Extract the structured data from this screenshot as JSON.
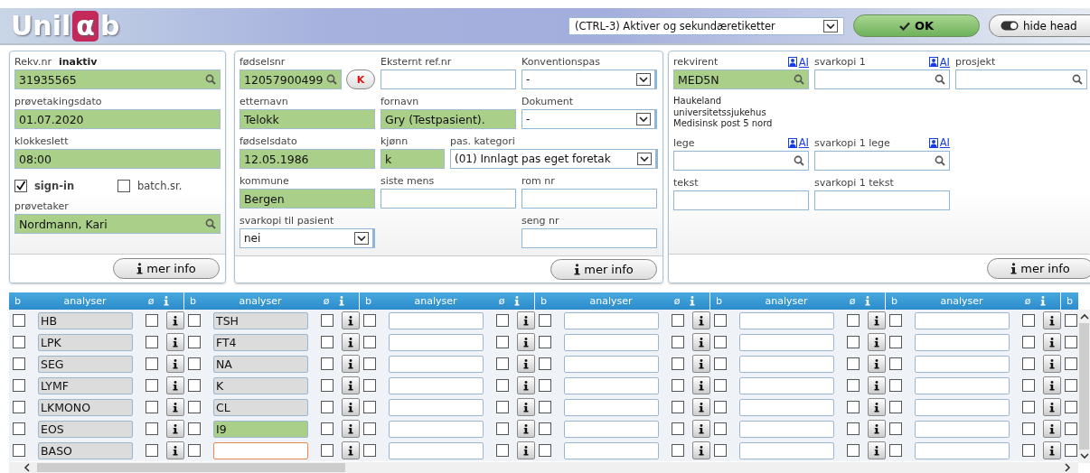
{
  "header": {
    "logo": {
      "prefix": "Unil",
      "mark": "α",
      "suffix": "b"
    },
    "print_select": "(CTRL-3) Aktiver og sekundæretiketter",
    "ok_button": "OK",
    "hide_button": "hide head"
  },
  "panels": [
    {
      "rows": [
        {
          "kind": "fields",
          "cells": [
            {
              "label": "Rekv.nr",
              "status": "inaktiv",
              "field": {
                "kind": "search",
                "value": "31935565",
                "highlighted": true
              }
            }
          ]
        },
        {
          "kind": "fields",
          "cells": [
            {
              "label": "prøvetakingsdato",
              "field": {
                "kind": "text",
                "value": "01.07.2020",
                "highlighted": true
              }
            }
          ]
        },
        {
          "kind": "fields",
          "cells": [
            {
              "label": "klokkeslett",
              "field": {
                "kind": "text",
                "value": "08:00",
                "highlighted": true
              }
            }
          ]
        },
        {
          "kind": "checks",
          "items": [
            {
              "label": "sign-in",
              "checked": true
            },
            {
              "label": "batch.sr.",
              "checked": false
            }
          ]
        },
        {
          "kind": "fields",
          "cells": [
            {
              "label": "prøvetaker",
              "field": {
                "kind": "search",
                "value": "Nordmann, Kari",
                "highlighted": true
              }
            }
          ]
        }
      ],
      "footer_button": "mer info"
    },
    {
      "rows": [
        {
          "kind": "fields",
          "cells": [
            {
              "label": "fødselsnr",
              "field": {
                "kind": "search",
                "value": "12057900499",
                "highlighted": true
              },
              "button": "K"
            },
            {
              "label": "Eksternt ref.nr",
              "field": {
                "kind": "text",
                "highlighted": false
              }
            },
            {
              "label": "Konventionspas",
              "field": {
                "kind": "select",
                "value": "-",
                "highlighted": false
              }
            }
          ]
        },
        {
          "kind": "fields",
          "cells": [
            {
              "label": "etternavn",
              "field": {
                "kind": "text",
                "value": "Telokk",
                "highlighted": true
              }
            },
            {
              "label": "fornavn",
              "field": {
                "kind": "text",
                "value": "Gry (Testpasient).",
                "highlighted": true
              }
            },
            {
              "label": "Dokument",
              "field": {
                "kind": "select",
                "value": "-",
                "highlighted": false
              }
            }
          ]
        },
        {
          "kind": "fields",
          "cells": [
            {
              "label": "fødselsdato",
              "field": {
                "kind": "text",
                "value": "12.05.1986",
                "highlighted": true
              }
            },
            {
              "label": "kjønn",
              "field": {
                "kind": "text",
                "value": "k",
                "highlighted": true
              }
            },
            {
              "label": "pas. kategori",
              "field": {
                "kind": "select",
                "value": "(01) Innlagt pas eget foretak",
                "highlighted": false
              }
            }
          ]
        },
        {
          "kind": "fields",
          "cells": [
            {
              "label": "kommune",
              "field": {
                "kind": "text",
                "value": "Bergen",
                "highlighted": true
              }
            },
            {
              "label": "siste mens",
              "field": {
                "kind": "text",
                "highlighted": false
              }
            },
            {
              "label": "rom nr",
              "field": {
                "kind": "text",
                "highlighted": false
              }
            }
          ]
        },
        {
          "kind": "fields",
          "cells": [
            {
              "label": "svarkopi til pasient",
              "field": {
                "kind": "select",
                "value": "nei",
                "highlighted": false
              }
            },
            "",
            {
              "label": "seng nr",
              "field": {
                "kind": "text",
                "highlighted": false
              }
            }
          ]
        }
      ],
      "footer_button": "mer info"
    },
    {
      "rows": [
        {
          "kind": "fields",
          "cells": [
            {
              "label": "rekvirent",
              "link": "AI",
              "field": {
                "kind": "search",
                "value": "MED5N",
                "highlighted": true
              }
            },
            {
              "label": "svarkopi 1",
              "link": "AI",
              "field": {
                "kind": "search",
                "highlighted": false
              }
            },
            {
              "label": "prosjekt",
              "field": {
                "kind": "search",
                "highlighted": false
              }
            }
          ]
        },
        {
          "kind": "note",
          "text": "Haukeland universitetssjukehus\nMedisinsk post 5 nord"
        },
        {
          "kind": "fields",
          "cells": [
            {
              "label": "lege",
              "link": "AI",
              "field": {
                "kind": "search",
                "highlighted": false
              }
            },
            {
              "label": "svarkopi 1 lege",
              "link": "AI",
              "field": {
                "kind": "search",
                "highlighted": false
              }
            }
          ]
        },
        {
          "kind": "fields",
          "cells": [
            {
              "label": "tekst",
              "field": {
                "kind": "text",
                "highlighted": false
              }
            },
            {
              "label": "svarkopi 1 tekst",
              "field": {
                "kind": "text",
                "highlighted": false
              }
            }
          ]
        }
      ],
      "footer_button": "mer info"
    }
  ],
  "analysis_grid": {
    "groups": [
      {
        "headers": [
          "b",
          "analyser",
          "ø"
        ]
      },
      {
        "headers": [
          "b",
          "analyser",
          "ø"
        ]
      },
      {
        "headers": [
          "b",
          "analyser",
          "ø"
        ]
      },
      {
        "headers": [
          "b",
          "analyser",
          "ø"
        ]
      },
      {
        "headers": [
          "b",
          "analyser",
          "ø"
        ]
      },
      {
        "headers": [
          "b",
          "analyser",
          "ø"
        ]
      }
    ],
    "extra_header": "b",
    "rows": [
      {
        "cells": [
          {
            "b": false,
            "value": "HB",
            "kind": "locked",
            "none": false
          },
          {
            "b": false,
            "value": "TSH",
            "kind": "locked",
            "none": false
          },
          {
            "b": false,
            "kind": "empty",
            "none": false
          },
          {
            "b": false,
            "kind": "empty",
            "none": false
          },
          {
            "b": false,
            "kind": "empty",
            "none": false
          },
          {
            "b": false,
            "kind": "empty",
            "none": false
          }
        ],
        "extra_b": false
      },
      {
        "cells": [
          {
            "b": false,
            "value": "LPK",
            "kind": "locked",
            "none": false
          },
          {
            "b": false,
            "value": "FT4",
            "kind": "locked",
            "none": false
          },
          {
            "b": false,
            "kind": "empty",
            "none": false
          },
          {
            "b": false,
            "kind": "empty",
            "none": false
          },
          {
            "b": false,
            "kind": "empty",
            "none": false
          },
          {
            "b": false,
            "kind": "empty",
            "none": false
          }
        ],
        "extra_b": false
      },
      {
        "cells": [
          {
            "b": false,
            "value": "SEG",
            "kind": "locked",
            "none": false
          },
          {
            "b": false,
            "value": "NA",
            "kind": "locked",
            "none": false
          },
          {
            "b": false,
            "kind": "empty",
            "none": false
          },
          {
            "b": false,
            "kind": "empty",
            "none": false
          },
          {
            "b": false,
            "kind": "empty",
            "none": false
          },
          {
            "b": false,
            "kind": "empty",
            "none": false
          }
        ],
        "extra_b": false
      },
      {
        "cells": [
          {
            "b": false,
            "value": "LYMF",
            "kind": "locked",
            "none": false
          },
          {
            "b": false,
            "value": "K",
            "kind": "locked",
            "none": false
          },
          {
            "b": false,
            "kind": "empty",
            "none": false
          },
          {
            "b": false,
            "kind": "empty",
            "none": false
          },
          {
            "b": false,
            "kind": "empty",
            "none": false
          },
          {
            "b": false,
            "kind": "empty",
            "none": false
          }
        ],
        "extra_b": false
      },
      {
        "cells": [
          {
            "b": false,
            "value": "LKMONO",
            "kind": "locked",
            "none": false
          },
          {
            "b": false,
            "value": "CL",
            "kind": "locked",
            "none": false
          },
          {
            "b": false,
            "kind": "empty",
            "none": false
          },
          {
            "b": false,
            "kind": "empty",
            "none": false
          },
          {
            "b": false,
            "kind": "empty",
            "none": false
          },
          {
            "b": false,
            "kind": "empty",
            "none": false
          }
        ],
        "extra_b": false
      },
      {
        "cells": [
          {
            "b": false,
            "value": "EOS",
            "kind": "locked",
            "none": false
          },
          {
            "b": false,
            "value": "I9",
            "kind": "valid",
            "none": false
          },
          {
            "b": false,
            "kind": "empty",
            "none": false
          },
          {
            "b": false,
            "kind": "empty",
            "none": false
          },
          {
            "b": false,
            "kind": "empty",
            "none": false
          },
          {
            "b": false,
            "kind": "empty",
            "none": false
          }
        ],
        "extra_b": false
      },
      {
        "cells": [
          {
            "b": false,
            "value": "BASO",
            "kind": "locked",
            "none": false
          },
          {
            "b": false,
            "kind": "focused",
            "none": false
          },
          {
            "b": false,
            "kind": "empty",
            "none": false
          },
          {
            "b": false,
            "kind": "empty",
            "none": false
          },
          {
            "b": false,
            "kind": "empty",
            "none": false
          },
          {
            "b": false,
            "kind": "empty",
            "none": false
          }
        ],
        "extra_b": false
      }
    ]
  }
}
